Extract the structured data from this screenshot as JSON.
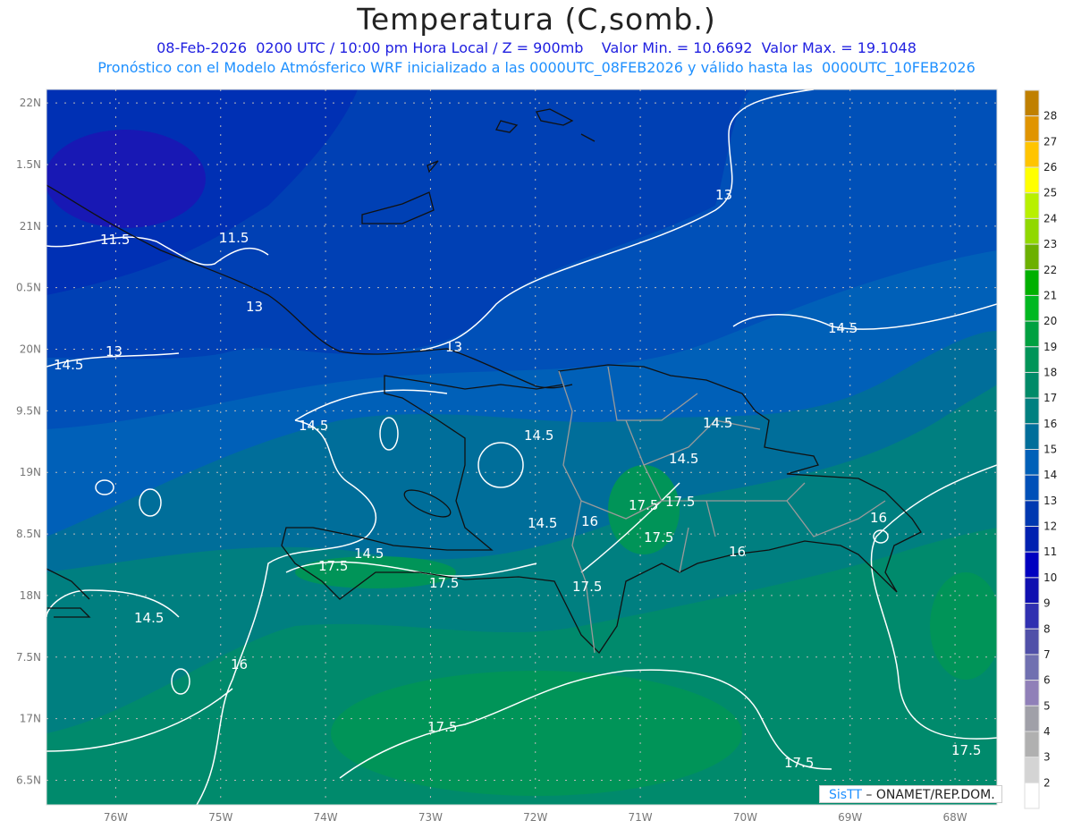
{
  "header": {
    "title": "Temperatura (C,somb.)",
    "line1": "08-Feb-2026  0200 UTC / 10:00 pm Hora Local / Z = 900mb    Valor Min. = 10.6692  Valor Max. = 19.1048",
    "line2": "Pronóstico con el Modelo Atmósferico WRF inicializado a las 0000UTC_08FEB2026 y válido hasta las  0000UTC_10FEB2026"
  },
  "map": {
    "lon_range": [
      -76.66,
      -67.6
    ],
    "lat_range": [
      16.3,
      22.11
    ],
    "x_ticks": [
      {
        "value": -76,
        "label": "76W"
      },
      {
        "value": -75,
        "label": "75W"
      },
      {
        "value": -74,
        "label": "74W"
      },
      {
        "value": -73,
        "label": "73W"
      },
      {
        "value": -72,
        "label": "72W"
      },
      {
        "value": -71,
        "label": "71W"
      },
      {
        "value": -70,
        "label": "70W"
      },
      {
        "value": -69,
        "label": "69W"
      },
      {
        "value": -68,
        "label": "68W"
      }
    ],
    "y_ticks": [
      {
        "value": 22,
        "label": "22N"
      },
      {
        "value": 21.5,
        "label": "1.5N"
      },
      {
        "value": 21,
        "label": "21N"
      },
      {
        "value": 20.5,
        "label": "0.5N"
      },
      {
        "value": 20,
        "label": "20N"
      },
      {
        "value": 19.5,
        "label": "9.5N"
      },
      {
        "value": 19,
        "label": "19N"
      },
      {
        "value": 18.5,
        "label": "8.5N"
      },
      {
        "value": 18,
        "label": "18N"
      },
      {
        "value": 17.5,
        "label": "7.5N"
      },
      {
        "value": 17,
        "label": "17N"
      },
      {
        "value": 16.5,
        "label": "6.5N"
      }
    ],
    "contour_labels": [
      "11.5",
      "11.5",
      "13",
      "13",
      "13",
      "13",
      "14.5",
      "14.5",
      "14.5",
      "14.5",
      "14.5",
      "14.5",
      "14.5",
      "14.5",
      "14.5",
      "16",
      "16",
      "16",
      "16",
      "17.5",
      "17.5",
      "17.5",
      "17.5",
      "17.5",
      "17.5",
      "17.5",
      "17.5",
      "17.5"
    ]
  },
  "colorbar": {
    "labels": [
      "28",
      "27",
      "26",
      "25",
      "24",
      "23",
      "22",
      "21",
      "20",
      "19",
      "18",
      "17",
      "16",
      "15",
      "14",
      "13",
      "12",
      "11",
      "10",
      "9",
      "8",
      "7",
      "6",
      "5",
      "4",
      "3",
      "2"
    ],
    "colors": [
      "#c08000",
      "#e09400",
      "#ffc400",
      "#ffff00",
      "#b8f000",
      "#90d800",
      "#6cb000",
      "#00b000",
      "#00b820",
      "#00a040",
      "#009458",
      "#008a68",
      "#008080",
      "#006e9a",
      "#0060b8",
      "#0050b8",
      "#0038b0",
      "#0020b0",
      "#0000c0",
      "#1010b0",
      "#3030b0",
      "#5050a8",
      "#7070b0",
      "#9080b8",
      "#a0a0a8",
      "#b0b0b0",
      "#d4d4d4",
      "#ffffff"
    ]
  },
  "credit": {
    "brand": "SisTT",
    "text": " – ONAMET/REP.DOM."
  }
}
